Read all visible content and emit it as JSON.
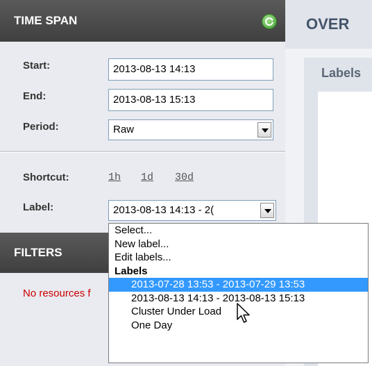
{
  "time_span": {
    "title": "TIME SPAN",
    "start_label": "Start:",
    "start_value": "2013-08-13 14:13",
    "end_label": "End:",
    "end_value": "2013-08-13 15:13",
    "period_label": "Period:",
    "period_value": "Raw",
    "shortcut_label": "Shortcut:",
    "shortcuts": [
      "1h",
      "1d",
      "30d"
    ],
    "label_label": "Label:",
    "label_value": "2013-08-13 14:13 - 2("
  },
  "filters": {
    "title": "FILTERS",
    "message": "No resources f"
  },
  "overview": {
    "title": "OVER",
    "labels_title": "Labels"
  },
  "label_dropdown": {
    "options": [
      "Select...",
      "New label...",
      "Edit labels..."
    ],
    "group_label": "Labels",
    "group_items": [
      "2013-07-28 13:53 - 2013-07-29 13:53",
      "2013-08-13 14:13 - 2013-08-13 15:13",
      "Cluster Under Load",
      "One Day"
    ],
    "selected_index": 0
  },
  "icons": {
    "refresh": "refresh-icon",
    "cursor": "mouse-pointer-icon"
  },
  "colors": {
    "header_bg": "#4a4a4a",
    "selected_bg": "#3399ff",
    "error_text": "#cc0000"
  }
}
